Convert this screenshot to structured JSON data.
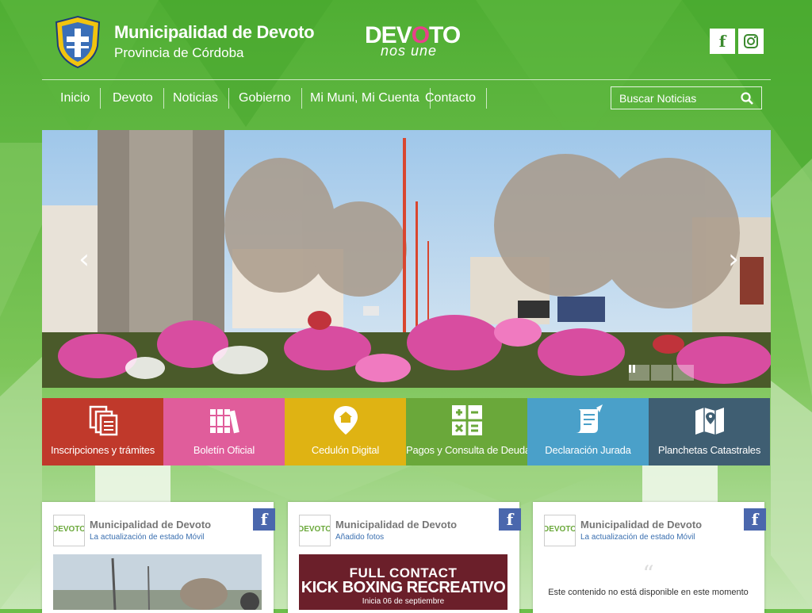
{
  "header": {
    "title": "Municipalidad de Devoto",
    "subtitle": "Provincia de Córdoba",
    "brand_main_left": "DEV",
    "brand_main_heart": "O",
    "brand_main_right": "TO",
    "brand_tagline": "nos une",
    "crest_text": "Municipalidad de DEVOTO",
    "social": {
      "facebook": "f",
      "instagram_icon": "instagram-icon"
    }
  },
  "nav": {
    "items": [
      "Inicio",
      "Devoto",
      "Noticias",
      "Gobierno",
      "Mi Muni, Mi Cuenta",
      "Contacto"
    ],
    "search_placeholder": "Buscar Noticias"
  },
  "slider": {
    "prev": "‹",
    "next": "›",
    "image": "street-with-flowers-photo"
  },
  "tiles": [
    {
      "label": "Inscripciones y trámites",
      "color": "#c0392b",
      "icon": "documents-icon"
    },
    {
      "label": "Boletín Oficial",
      "color": "#e05d9b",
      "icon": "books-icon"
    },
    {
      "label": "Cedulón Digital",
      "color": "#dfb313",
      "icon": "home-pin-icon"
    },
    {
      "label": "Pagos y Consulta de Deuda",
      "color": "#6aa83a",
      "icon": "calculator-icon"
    },
    {
      "label": "Declaración Jurada",
      "color": "#4aa0c9",
      "icon": "scroll-icon"
    },
    {
      "label": "Planchetas Catastrales",
      "color": "#3f5e72",
      "icon": "map-icon"
    }
  ],
  "cards": [
    {
      "name": "Municipalidad de Devoto",
      "status": "La actualización de estado Móvil",
      "fb": "f"
    },
    {
      "name": "Municipalidad de Devoto",
      "status": "Añadido fotos",
      "fb": "f",
      "media_line1": "FULL CONTACT",
      "media_line2": "KICK BOXING RECREATIVO",
      "media_line3": "Inicia 06 de septiembre"
    },
    {
      "name": "Municipalidad de Devoto",
      "status": "La actualización de estado Móvil",
      "fb": "f",
      "quote": "“",
      "unavailable": "Este contenido no está disponible en este momento"
    }
  ],
  "colors": {
    "background": "#6cbf4a",
    "facebook": "#4a67ad"
  }
}
